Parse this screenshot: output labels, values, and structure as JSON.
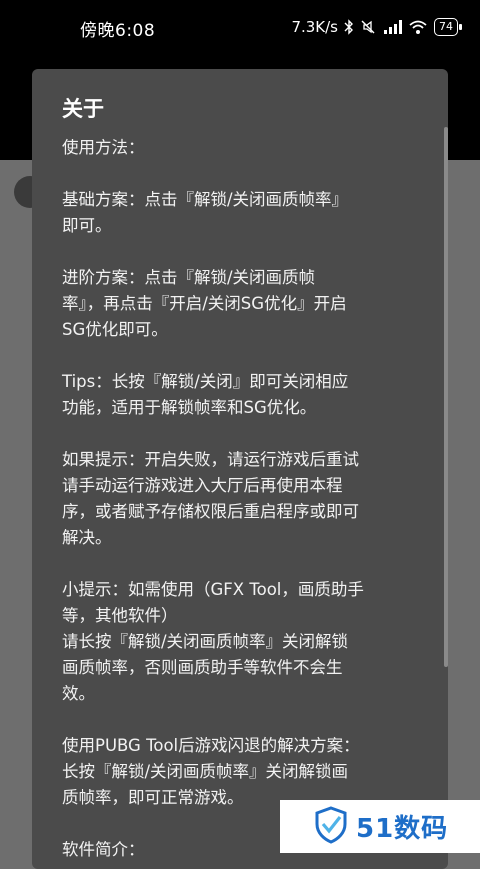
{
  "status_bar": {
    "time": "傍晚6:08",
    "network_speed": "7.3K/s",
    "battery": "74",
    "icons": [
      "bluetooth-icon",
      "mute-icon",
      "hd-signal-icon",
      "wifi-icon",
      "battery-icon"
    ]
  },
  "dialog": {
    "title": "关于",
    "paragraphs": [
      "使用方法：",
      "",
      "基础方案：点击『解锁/关闭画质帧率』\n即可。",
      "",
      "进阶方案：点击『解锁/关闭画质帧\n率』，再点击『开启/关闭SG优化』开启\nSG优化即可。",
      "",
      "Tips：长按『解锁/关闭』即可关闭相应\n功能，适用于解锁帧率和SG优化。",
      "",
      "如果提示：开启失败，请运行游戏后重试\n请手动运行游戏进入大厅后再使用本程\n序，或者赋予存储权限后重启程序或即可\n解决。",
      "",
      "小提示：如需使用（GFX Tool，画质助手\n等，其他软件）\n请长按『解锁/关闭画质帧率』关闭解锁\n画质帧率，否则画质助手等软件不会生\n效。",
      "",
      "使用PUBG Tool后游戏闪退的解决方案：\n长按『解锁/关闭画质帧率』关闭解锁画\n质帧率，即可正常游戏。",
      "",
      "软件简介："
    ]
  },
  "watermark": {
    "text": "51数码",
    "logo": "shield-logo-icon",
    "color": "#1e6ec8"
  },
  "colors": {
    "dialog_bg": "#4b4b4b",
    "scrim": "#6e6e6e",
    "status_bar_bg": "#000000"
  }
}
